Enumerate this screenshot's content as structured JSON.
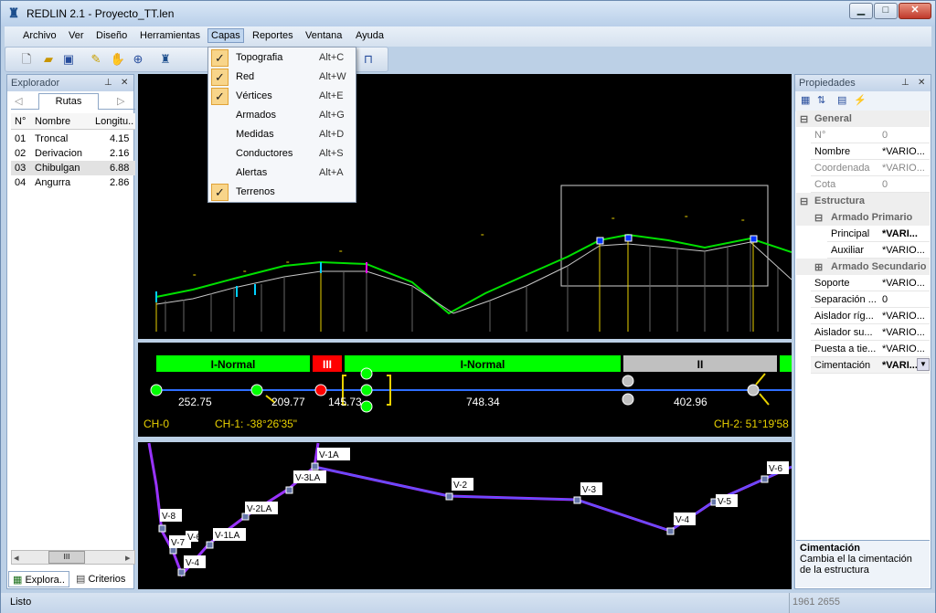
{
  "titlebar": {
    "title": "REDLIN 2.1 - Proyecto_TT.len",
    "min": "▁",
    "max": "□",
    "close": "✕"
  },
  "menubar": {
    "items": [
      "Archivo",
      "Ver",
      "Diseño",
      "Herramientas",
      "Capas",
      "Reportes",
      "Ventana",
      "Ayuda"
    ],
    "active": "Capas"
  },
  "capas_menu": [
    {
      "label": "Topografia",
      "shortcut": "Alt+C",
      "checked": true
    },
    {
      "label": "Red",
      "shortcut": "Alt+W",
      "checked": true
    },
    {
      "label": "Vértices",
      "shortcut": "Alt+E",
      "checked": true
    },
    {
      "label": "Armados",
      "shortcut": "Alt+G",
      "checked": false
    },
    {
      "label": "Medidas",
      "shortcut": "Alt+D",
      "checked": false
    },
    {
      "label": "Conductores",
      "shortcut": "Alt+S",
      "checked": false
    },
    {
      "label": "Alertas",
      "shortcut": "Alt+A",
      "checked": false
    },
    {
      "label": "Terrenos",
      "shortcut": "",
      "checked": true
    }
  ],
  "explorer": {
    "title": "Explorador",
    "tab": "Rutas",
    "columns": [
      "N°",
      "Nombre",
      "Longitu.."
    ],
    "rows": [
      {
        "n": "01",
        "nombre": "Troncal",
        "long": "4.15"
      },
      {
        "n": "02",
        "nombre": "Derivacion",
        "long": "2.16"
      },
      {
        "n": "03",
        "nombre": "Chibulgan",
        "long": "6.88"
      },
      {
        "n": "04",
        "nombre": "Angurra",
        "long": "2.86"
      }
    ],
    "scroll_label": "III",
    "bottom_tabs": [
      "Explora..",
      "Criterios"
    ]
  },
  "properties": {
    "title": "Propiedades",
    "general": "General",
    "rows_general": [
      {
        "k": "N°",
        "v": "0",
        "grey": true
      },
      {
        "k": "Nombre",
        "v": "*VARIO...",
        "grey": false
      },
      {
        "k": "Coordenada",
        "v": "*VARIO...",
        "grey": true
      },
      {
        "k": "Cota",
        "v": "0",
        "grey": true
      }
    ],
    "estructura": "Estructura",
    "armado_primario": "Armado Primario",
    "rows_primario": [
      {
        "k": "Principal",
        "v": "*VARI...",
        "bold": true
      },
      {
        "k": "Auxiliar",
        "v": "*VARIO...",
        "bold": false
      }
    ],
    "armado_secundario": "Armado Secundario",
    "rows_other": [
      {
        "k": "Soporte",
        "v": "*VARIO..."
      },
      {
        "k": "Separación ...",
        "v": "0"
      },
      {
        "k": "Aislador ríg...",
        "v": "*VARIO..."
      },
      {
        "k": "Aislador su...",
        "v": "*VARIO..."
      },
      {
        "k": "Puesta a tie...",
        "v": "*VARIO..."
      },
      {
        "k": "Cimentación",
        "v": "*VARI..."
      }
    ],
    "help_title": "Cimentación",
    "help_text": "Cambia el la cimentación de la estructura"
  },
  "profile": {
    "bands": [
      {
        "label": "I-Normal",
        "color": "#00ff00"
      },
      {
        "label": "III",
        "color": "#ff0000"
      },
      {
        "label": "I-Normal",
        "color": "#00ff00"
      },
      {
        "label": "II",
        "color": "#c0c0c0"
      }
    ],
    "distances": [
      "252.75",
      "209.77",
      "145.73",
      "748.34",
      "402.96"
    ],
    "ch_labels": [
      "CH-0",
      "CH-1: -38°26'35\"",
      "CH-2: 51°19'58"
    ]
  },
  "plan": {
    "vertices": [
      "V-1A",
      "V-3LA",
      "V-2",
      "V-3",
      "V-4",
      "V-5",
      "V-6",
      "V-8",
      "V-7",
      "V-6",
      "V-4",
      "V-1LA",
      "V-2LA"
    ]
  },
  "status": {
    "left": "Listo",
    "coords": "1961 2655"
  },
  "colors": {
    "green": "#00ff00",
    "red": "#ff0000",
    "purple": "#9933ff",
    "yellow": "#e8d000"
  }
}
